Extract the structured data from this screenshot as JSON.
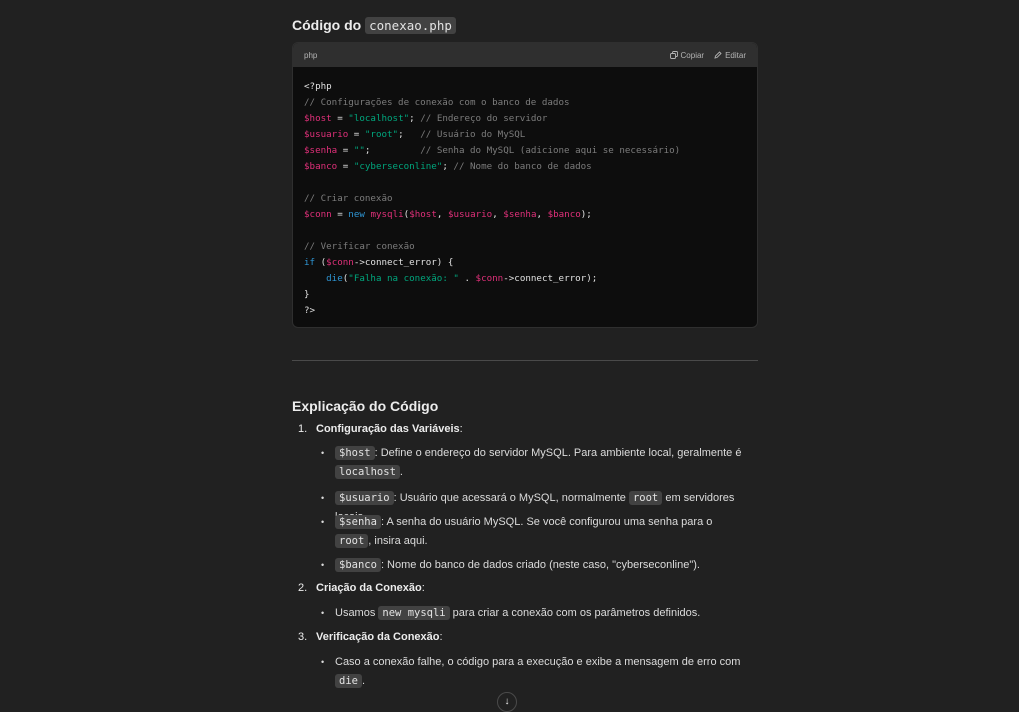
{
  "heading": {
    "prefix": "Código do",
    "file": "conexao.php"
  },
  "code": {
    "language": "php",
    "copy_label": "Copiar",
    "edit_label": "Editar",
    "lines": [
      [
        {
          "t": "plain",
          "v": "<?php"
        }
      ],
      [
        {
          "t": "comment",
          "v": "// Configurações de conexão com o banco de dados"
        }
      ],
      [
        {
          "t": "var",
          "v": "$host"
        },
        {
          "t": "plain",
          "v": " = "
        },
        {
          "t": "str",
          "v": "\"localhost\""
        },
        {
          "t": "plain",
          "v": "; "
        },
        {
          "t": "comment",
          "v": "// Endereço do servidor"
        }
      ],
      [
        {
          "t": "var",
          "v": "$usuario"
        },
        {
          "t": "plain",
          "v": " = "
        },
        {
          "t": "str",
          "v": "\"root\""
        },
        {
          "t": "plain",
          "v": ";   "
        },
        {
          "t": "comment",
          "v": "// Usuário do MySQL"
        }
      ],
      [
        {
          "t": "var",
          "v": "$senha"
        },
        {
          "t": "plain",
          "v": " = "
        },
        {
          "t": "str",
          "v": "\"\""
        },
        {
          "t": "plain",
          "v": ";         "
        },
        {
          "t": "comment",
          "v": "// Senha do MySQL (adicione aqui se necessário)"
        }
      ],
      [
        {
          "t": "var",
          "v": "$banco"
        },
        {
          "t": "plain",
          "v": " = "
        },
        {
          "t": "str",
          "v": "\"cyberseconline\""
        },
        {
          "t": "plain",
          "v": "; "
        },
        {
          "t": "comment",
          "v": "// Nome do banco de dados"
        }
      ],
      [],
      [
        {
          "t": "comment",
          "v": "// Criar conexão"
        }
      ],
      [
        {
          "t": "var",
          "v": "$conn"
        },
        {
          "t": "plain",
          "v": " = "
        },
        {
          "t": "kw",
          "v": "new"
        },
        {
          "t": "plain",
          "v": " "
        },
        {
          "t": "fn",
          "v": "mysqli"
        },
        {
          "t": "plain",
          "v": "("
        },
        {
          "t": "var",
          "v": "$host"
        },
        {
          "t": "plain",
          "v": ", "
        },
        {
          "t": "var",
          "v": "$usuario"
        },
        {
          "t": "plain",
          "v": ", "
        },
        {
          "t": "var",
          "v": "$senha"
        },
        {
          "t": "plain",
          "v": ", "
        },
        {
          "t": "var",
          "v": "$banco"
        },
        {
          "t": "plain",
          "v": ");"
        }
      ],
      [],
      [
        {
          "t": "comment",
          "v": "// Verificar conexão"
        }
      ],
      [
        {
          "t": "kw",
          "v": "if"
        },
        {
          "t": "plain",
          "v": " ("
        },
        {
          "t": "var",
          "v": "$conn"
        },
        {
          "t": "plain",
          "v": "->connect_error) {"
        }
      ],
      [
        {
          "t": "plain",
          "v": "    "
        },
        {
          "t": "kw",
          "v": "die"
        },
        {
          "t": "plain",
          "v": "("
        },
        {
          "t": "str",
          "v": "\"Falha na conexão: \""
        },
        {
          "t": "plain",
          "v": " . "
        },
        {
          "t": "var",
          "v": "$conn"
        },
        {
          "t": "plain",
          "v": "->connect_error);"
        }
      ],
      [
        {
          "t": "plain",
          "v": "}"
        }
      ],
      [
        {
          "t": "plain",
          "v": "?>"
        }
      ]
    ]
  },
  "explanation": {
    "title": "Explicação do Código",
    "items": [
      {
        "num": "1.",
        "title": "Configuração das Variáveis",
        "suffix": ":",
        "bullets": [
          [
            {
              "c": "$host"
            },
            {
              "x": ": Define o endereço do servidor MySQL. Para ambiente local, geralmente é "
            },
            {
              "c": "localhost"
            },
            {
              "x": "."
            }
          ],
          [
            {
              "c": "$usuario"
            },
            {
              "x": ": Usuário que acessará o MySQL, normalmente "
            },
            {
              "c": "root"
            },
            {
              "x": " em servidores locais."
            }
          ],
          [
            {
              "c": "$senha"
            },
            {
              "x": ": A senha do usuário MySQL. Se você configurou uma senha para o "
            },
            {
              "c": "root"
            },
            {
              "x": ", insira aqui."
            }
          ],
          [
            {
              "c": "$banco"
            },
            {
              "x": ": Nome do banco de dados criado (neste caso, \"cyberseconline\")."
            }
          ]
        ]
      },
      {
        "num": "2.",
        "title": "Criação da Conexão",
        "suffix": ":",
        "bullets": [
          [
            {
              "x": "Usamos "
            },
            {
              "c": "new mysqli"
            },
            {
              "x": " para criar a conexão com os parâmetros definidos."
            }
          ]
        ]
      },
      {
        "num": "3.",
        "title": "Verificação da Conexão",
        "suffix": ":",
        "bullets": [
          [
            {
              "x": "Caso a conexão falhe, o código para a execução e exibe a mensagem de erro com "
            },
            {
              "c": "die"
            },
            {
              "x": "."
            }
          ]
        ]
      }
    ]
  },
  "colors": {
    "background": "#212121",
    "code_bg": "#0d0d0d",
    "variable": "#df3079",
    "string": "#00a67d",
    "keyword": "#2e95d3",
    "comment": "#7c7c7c"
  },
  "scroll_button_icon": "arrow-down-icon"
}
